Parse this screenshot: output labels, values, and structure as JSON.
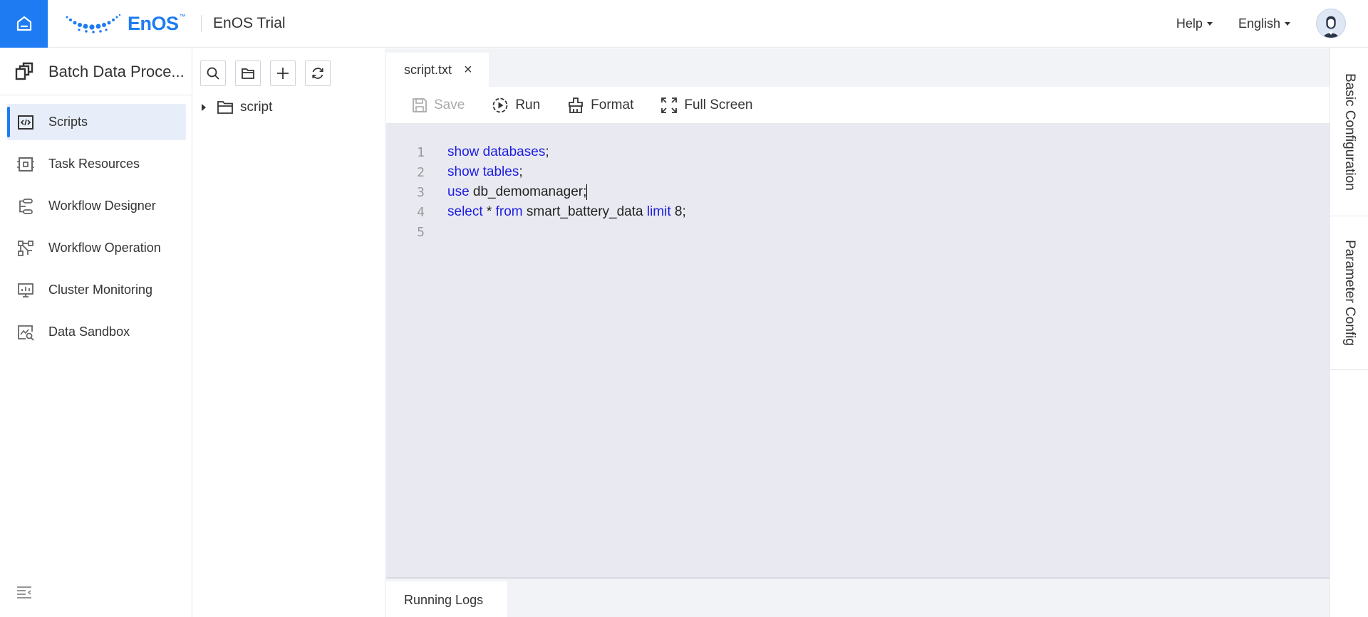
{
  "header": {
    "brand": "EnOS",
    "brand_tm": "™",
    "app_title": "EnOS Trial",
    "help_label": "Help",
    "language_label": "English"
  },
  "sidebar": {
    "title": "Batch Data Proce...",
    "items": [
      {
        "label": "Scripts",
        "icon": "script-icon",
        "active": true
      },
      {
        "label": "Task Resources",
        "icon": "chip-icon"
      },
      {
        "label": "Workflow Designer",
        "icon": "workflow-designer-icon"
      },
      {
        "label": "Workflow Operation",
        "icon": "workflow-operation-icon"
      },
      {
        "label": "Cluster Monitoring",
        "icon": "monitor-icon"
      },
      {
        "label": "Data Sandbox",
        "icon": "sandbox-icon"
      }
    ]
  },
  "file_tree": {
    "root_folder": "script"
  },
  "editor": {
    "tab_label": "script.txt",
    "tab_close": "×",
    "toolbar": {
      "save": "Save",
      "run": "Run",
      "format": "Format",
      "fullscreen": "Full Screen"
    },
    "line_numbers": [
      "1",
      "2",
      "3",
      "4",
      "5"
    ],
    "lines": [
      [
        {
          "t": "show databases",
          "k": true
        },
        {
          "t": ";",
          "k": false
        }
      ],
      [
        {
          "t": "show tables",
          "k": true
        },
        {
          "t": ";",
          "k": false
        }
      ],
      [
        {
          "t": "use",
          "k": true
        },
        {
          "t": " db_demomanager;",
          "k": false
        }
      ],
      [
        {
          "t": "select",
          "k": true
        },
        {
          "t": " * ",
          "k": false
        },
        {
          "t": "from",
          "k": true
        },
        {
          "t": " smart_battery_data ",
          "k": false
        },
        {
          "t": "limit",
          "k": true
        },
        {
          "t": " 8;",
          "k": false
        }
      ],
      []
    ],
    "cursor_line": 3
  },
  "logs": {
    "tab_label": "Running Logs"
  },
  "right_panel": {
    "basic_config": "Basic Configuration",
    "param_config": "Parameter Config"
  },
  "colors": {
    "accent": "#1e7bf2",
    "keyword": "#1d1de0",
    "editor_bg": "#e9eaf1"
  }
}
